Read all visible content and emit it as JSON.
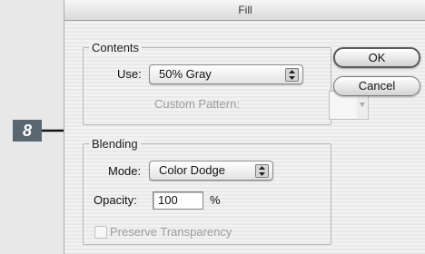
{
  "dialog": {
    "title": "Fill",
    "contents": {
      "legend": "Contents",
      "use_label": "Use:",
      "use_value": "50% Gray",
      "custom_pattern_label": "Custom Pattern:"
    },
    "blending": {
      "legend": "Blending",
      "mode_label": "Mode:",
      "mode_value": "Color Dodge",
      "opacity_label": "Opacity:",
      "opacity_value": "100",
      "opacity_unit": "%",
      "preserve_label": "Preserve Transparency",
      "preserve_checked": false
    },
    "buttons": {
      "ok": "OK",
      "cancel": "Cancel"
    }
  },
  "callout": {
    "number": "8"
  },
  "colors": {
    "callout_bg": "#5b6770",
    "callout_arrow": "#111111"
  }
}
